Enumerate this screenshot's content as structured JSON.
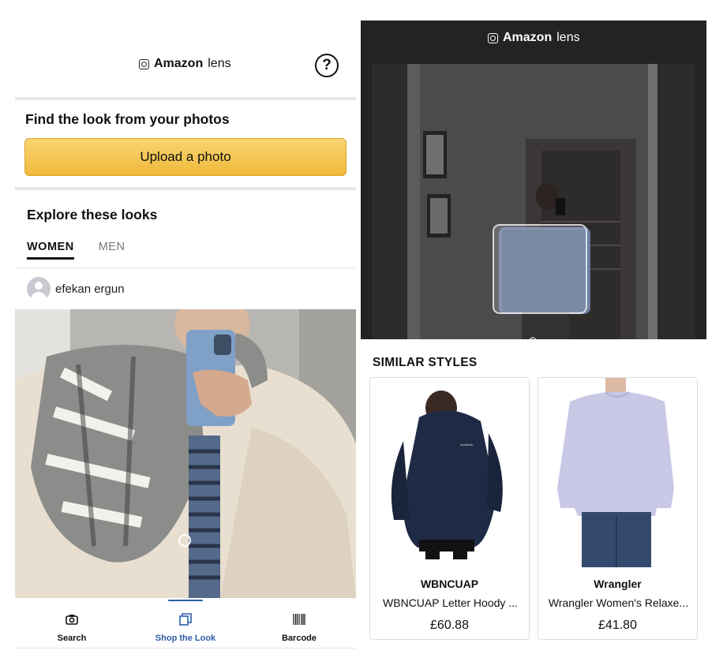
{
  "left_screen": {
    "header": {
      "brand": "Amazon",
      "title_suffix": "lens",
      "help_icon": "question-circle-icon",
      "help_label": "?"
    },
    "find_section": {
      "title": "Find the look from your photos",
      "upload_button": "Upload a photo"
    },
    "explore_section": {
      "title": "Explore these looks",
      "tabs": [
        {
          "label": "WOMEN",
          "active": true
        },
        {
          "label": "MEN",
          "active": false
        }
      ]
    },
    "post": {
      "username": "efekan ergun",
      "avatar_icon": "user-avatar-icon"
    },
    "bottom_nav": [
      {
        "label": "Search",
        "icon": "camera-icon",
        "active": false
      },
      {
        "label": "Shop the Look",
        "icon": "stacked-cards-icon",
        "active": true
      },
      {
        "label": "Barcode",
        "icon": "barcode-icon",
        "active": false
      }
    ],
    "colors": {
      "upload_button": "#f0b93a",
      "active_nav": "#2b5ea7"
    }
  },
  "right_screen": {
    "header": {
      "brand": "Amazon",
      "title_suffix": "lens"
    },
    "results_title": "SIMILAR STYLES",
    "products": [
      {
        "brand": "WBNCUAP",
        "title": "WBNCUAP Letter Hoody ...",
        "price": "£60.88",
        "color": "#1f2b45"
      },
      {
        "brand": "Wrangler",
        "title": "Wrangler Women's Relaxe...",
        "price": "£41.80",
        "color": "#c9c8e6"
      }
    ]
  }
}
